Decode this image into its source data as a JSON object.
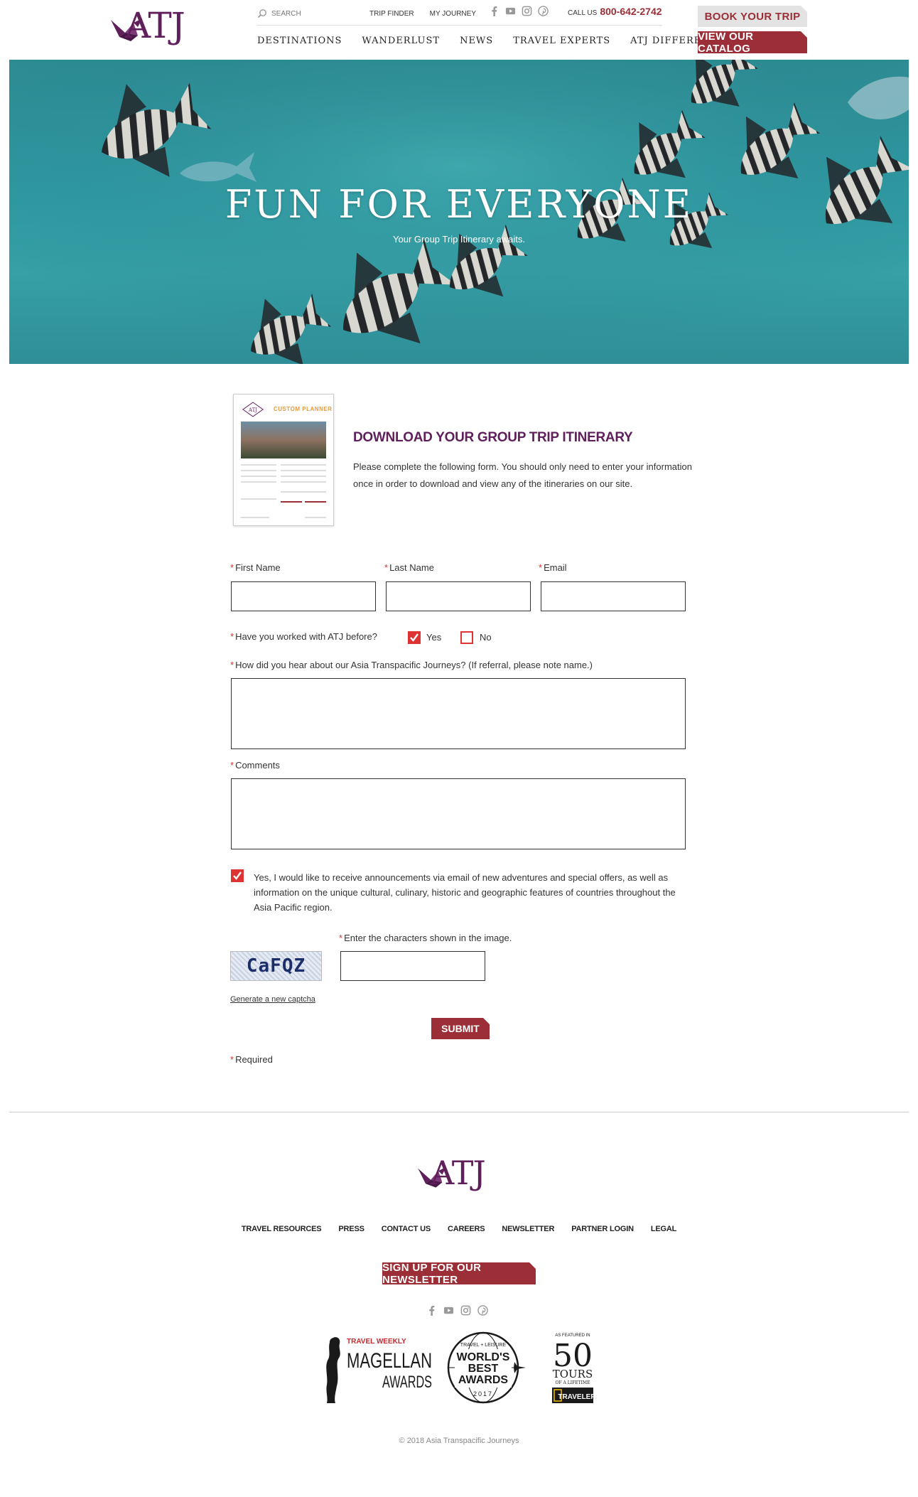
{
  "brand": {
    "logo_text": "ATJ",
    "color": "#5f1f5b",
    "accent": "#9b2e36"
  },
  "header": {
    "search_placeholder": "SEARCH",
    "util_links": [
      "TRIP FINDER",
      "MY JOURNEY"
    ],
    "social_icons": [
      "facebook-icon",
      "youtube-icon",
      "instagram-icon",
      "pinterest-icon"
    ],
    "call_label": "CALL US",
    "phone": "800-642-2742",
    "nav": [
      "DESTINATIONS",
      "WANDERLUST",
      "NEWS",
      "TRAVEL EXPERTS",
      "ATJ DIFFERENCE"
    ],
    "book_label": "BOOK YOUR TRIP",
    "catalog_label": "VIEW OUR CATALOG"
  },
  "hero": {
    "title": "FUN FOR EVERYONE",
    "subtitle": "Your Group Trip Itinerary awaits."
  },
  "intro": {
    "thumb_title": "CUSTOM PLANNER",
    "title": "DOWNLOAD YOUR GROUP TRIP ITINERARY",
    "text": "Please complete the following form. You should only need to enter your information once in order to download and view any of the itineraries on our site."
  },
  "form": {
    "first_name_label": "First Name",
    "last_name_label": "Last Name",
    "email_label": "Email",
    "first_name_value": "",
    "last_name_value": "",
    "email_value": "",
    "worked_question": "Have you worked with ATJ before?",
    "yes_label": "Yes",
    "no_label": "No",
    "worked_answer": "Yes",
    "hear_label": "How did you hear about our Asia Transpacific Journeys? (If referral, please note name.)",
    "hear_value": "",
    "comments_label": "Comments",
    "comments_value": "",
    "optin_checked": true,
    "optin_text": "Yes, I would like to receive announcements via email of new adventures and special offers, as well as information on the unique cultural, culinary, historic and geographic features of countries throughout the Asia Pacific region.",
    "captcha_text": "CaFQZ",
    "captcha_label": "Enter the characters shown in the image.",
    "captcha_value": "",
    "new_captcha_label": "Generate a new captcha",
    "submit_label": "SUBMIT",
    "required_note": "Required",
    "required_mark": "*"
  },
  "footer": {
    "logo_text": "ATJ",
    "links": [
      "TRAVEL RESOURCES",
      "PRESS",
      "CONTACT US",
      "CAREERS",
      "NEWSLETTER",
      "PARTNER LOGIN",
      "LEGAL"
    ],
    "newsletter_label": "SIGN UP FOR OUR NEWSLETTER",
    "social_icons": [
      "facebook-icon",
      "youtube-icon",
      "instagram-icon",
      "pinterest-icon"
    ],
    "awards": {
      "magellan": {
        "small": "TRAVEL WEEKLY",
        "big": "MAGELLAN",
        "sub": "AWARDS"
      },
      "worlds_best": {
        "top": "TRAVEL + LEISURE",
        "line1": "WORLD'S",
        "line2": "BEST",
        "line3": "AWARDS",
        "year": "2017"
      },
      "tours": {
        "top": "AS FEATURED IN",
        "number": "50",
        "word": "TOURS",
        "sub": "OF A LIFETIME",
        "pub": "TRAVELER"
      }
    },
    "copyright": "© 2018 Asia Transpacific Journeys"
  }
}
